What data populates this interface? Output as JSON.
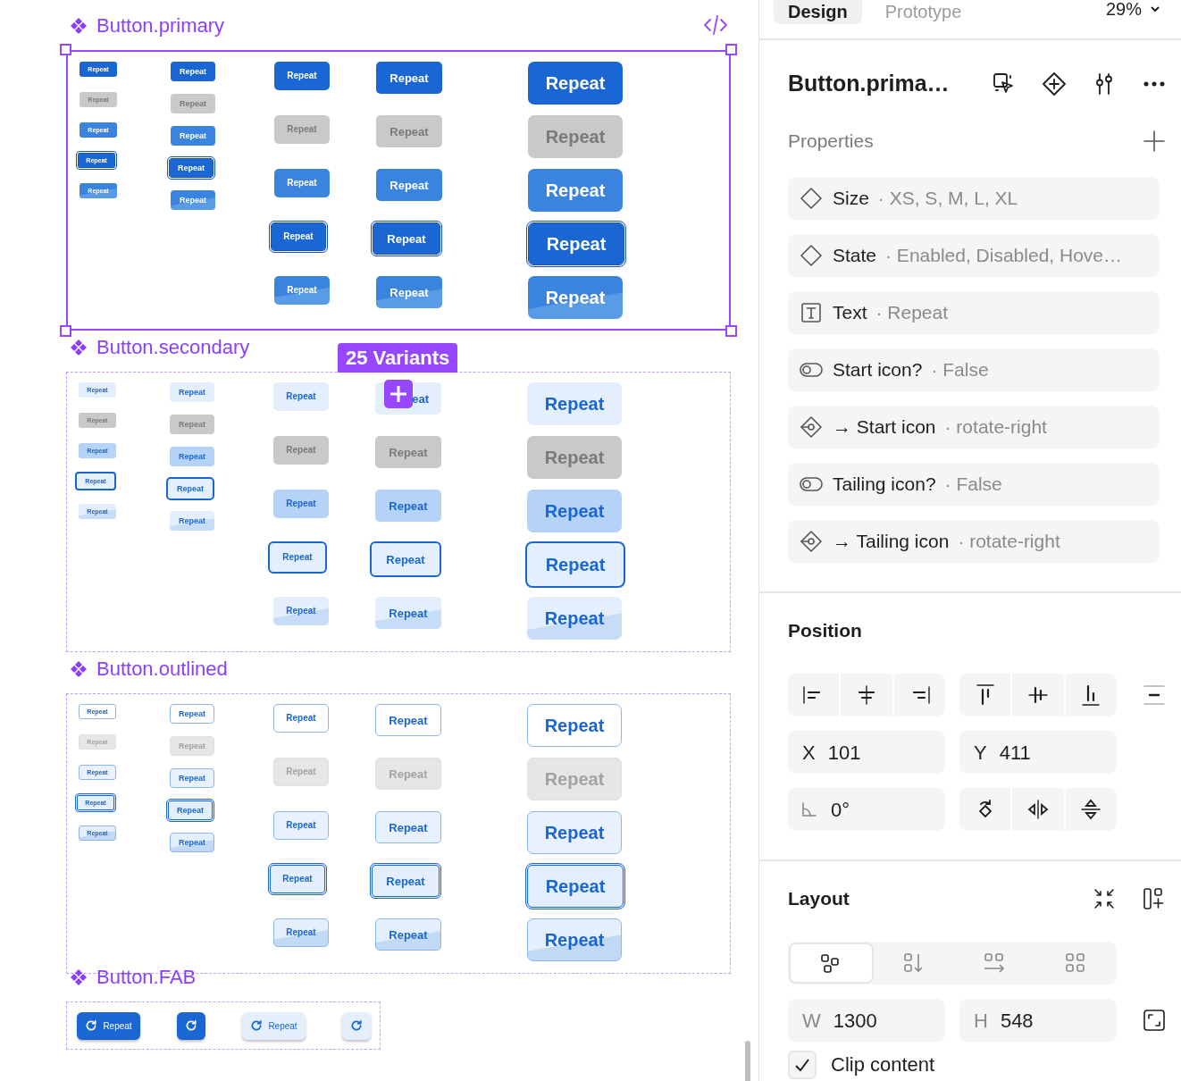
{
  "canvas": {
    "badge": "25 Variants",
    "sections": [
      {
        "title": "Button.primary",
        "kind": "primary",
        "selected": true,
        "columns": [
          {
            "kind": "XS",
            "buttons": [
              {
                "kind": "enabled",
                "label": "Repeat"
              },
              {
                "kind": "disabled",
                "label": "Repeat"
              },
              {
                "kind": "hovered",
                "label": "Repeat"
              },
              {
                "kind": "focused",
                "label": "Repeat"
              },
              {
                "kind": "pressed",
                "label": "Repeat"
              }
            ]
          },
          {
            "kind": "S",
            "buttons": [
              {
                "kind": "enabled",
                "label": "Repeat"
              },
              {
                "kind": "disabled",
                "label": "Repeat"
              },
              {
                "kind": "hovered",
                "label": "Repeat"
              },
              {
                "kind": "focused",
                "label": "Repeat"
              },
              {
                "kind": "pressed",
                "label": "Repeat"
              }
            ]
          },
          {
            "kind": "M",
            "buttons": [
              {
                "kind": "enabled",
                "label": "Repeat"
              },
              {
                "kind": "disabled",
                "label": "Repeat"
              },
              {
                "kind": "hovered",
                "label": "Repeat"
              },
              {
                "kind": "focused",
                "label": "Repeat"
              },
              {
                "kind": "pressed",
                "label": "Repeat"
              }
            ]
          },
          {
            "kind": "L",
            "buttons": [
              {
                "kind": "enabled",
                "label": "Repeat"
              },
              {
                "kind": "disabled",
                "label": "Repeat"
              },
              {
                "kind": "hovered",
                "label": "Repeat"
              },
              {
                "kind": "focused",
                "label": "Repeat"
              },
              {
                "kind": "pressed",
                "label": "Repeat"
              }
            ]
          },
          {
            "kind": "XL",
            "buttons": [
              {
                "kind": "enabled",
                "label": "Repeat"
              },
              {
                "kind": "disabled",
                "label": "Repeat"
              },
              {
                "kind": "hovered",
                "label": "Repeat"
              },
              {
                "kind": "focused",
                "label": "Repeat"
              },
              {
                "kind": "pressed",
                "label": "Repeat"
              }
            ]
          }
        ]
      },
      {
        "title": "Button.secondary",
        "kind": "secondary",
        "selected": false,
        "columns": [
          {
            "kind": "XS",
            "buttons": [
              {
                "kind": "enabled",
                "label": "Repeat"
              },
              {
                "kind": "disabled",
                "label": "Repeat"
              },
              {
                "kind": "hovered",
                "label": "Repeat"
              },
              {
                "kind": "focused",
                "label": "Repeat"
              },
              {
                "kind": "pressed",
                "label": "Repeat"
              }
            ]
          },
          {
            "kind": "S",
            "buttons": [
              {
                "kind": "enabled",
                "label": "Repeat"
              },
              {
                "kind": "disabled",
                "label": "Repeat"
              },
              {
                "kind": "hovered",
                "label": "Repeat"
              },
              {
                "kind": "focused",
                "label": "Repeat"
              },
              {
                "kind": "pressed",
                "label": "Repeat"
              }
            ]
          },
          {
            "kind": "M",
            "buttons": [
              {
                "kind": "enabled",
                "label": "Repeat"
              },
              {
                "kind": "disabled",
                "label": "Repeat"
              },
              {
                "kind": "hovered",
                "label": "Repeat"
              },
              {
                "kind": "focused",
                "label": "Repeat"
              },
              {
                "kind": "pressed",
                "label": "Repeat"
              }
            ]
          },
          {
            "kind": "L",
            "buttons": [
              {
                "kind": "enabled",
                "label": "eat",
                "covered": true
              },
              {
                "kind": "disabled",
                "label": "Repeat"
              },
              {
                "kind": "hovered",
                "label": "Repeat"
              },
              {
                "kind": "focused",
                "label": "Repeat"
              },
              {
                "kind": "pressed",
                "label": "Repeat"
              }
            ]
          },
          {
            "kind": "XL",
            "buttons": [
              {
                "kind": "enabled",
                "label": "Repeat"
              },
              {
                "kind": "disabled",
                "label": "Repeat"
              },
              {
                "kind": "hovered",
                "label": "Repeat"
              },
              {
                "kind": "focused",
                "label": "Repeat"
              },
              {
                "kind": "pressed",
                "label": "Repeat"
              }
            ]
          }
        ]
      },
      {
        "title": "Button.outlined",
        "kind": "outlined",
        "selected": false,
        "columns": [
          {
            "kind": "XS",
            "buttons": [
              {
                "kind": "enabled",
                "label": "Repeat"
              },
              {
                "kind": "disabled",
                "label": "Repeat"
              },
              {
                "kind": "hovered",
                "label": "Repeat"
              },
              {
                "kind": "focused",
                "label": "Repeat"
              },
              {
                "kind": "pressed",
                "label": "Repeat"
              }
            ]
          },
          {
            "kind": "S",
            "buttons": [
              {
                "kind": "enabled",
                "label": "Repeat"
              },
              {
                "kind": "disabled",
                "label": "Repeat"
              },
              {
                "kind": "hovered",
                "label": "Repeat"
              },
              {
                "kind": "focused",
                "label": "Repeat"
              },
              {
                "kind": "pressed",
                "label": "Repeat"
              }
            ]
          },
          {
            "kind": "M",
            "buttons": [
              {
                "kind": "enabled",
                "label": "Repeat"
              },
              {
                "kind": "disabled",
                "label": "Repeat"
              },
              {
                "kind": "hovered",
                "label": "Repeat"
              },
              {
                "kind": "focused",
                "label": "Repeat"
              },
              {
                "kind": "pressed",
                "label": "Repeat"
              }
            ]
          },
          {
            "kind": "L",
            "buttons": [
              {
                "kind": "enabled",
                "label": "Repeat"
              },
              {
                "kind": "disabled",
                "label": "Repeat"
              },
              {
                "kind": "hovered",
                "label": "Repeat"
              },
              {
                "kind": "focused",
                "label": "Repeat"
              },
              {
                "kind": "pressed",
                "label": "Repeat"
              }
            ]
          },
          {
            "kind": "XL",
            "buttons": [
              {
                "kind": "enabled",
                "label": "Repeat"
              },
              {
                "kind": "disabled",
                "label": "Repeat"
              },
              {
                "kind": "hovered",
                "label": "Repeat"
              },
              {
                "kind": "focused",
                "label": "Repeat"
              },
              {
                "kind": "pressed",
                "label": "Repeat"
              }
            ]
          }
        ]
      }
    ],
    "fab": {
      "title": "Button.FAB",
      "selected": false,
      "buttons": [
        {
          "kind": "primary",
          "label": "Repeat"
        },
        {
          "kind": "primary"
        },
        {
          "kind": "secondary",
          "label": "Repeat"
        },
        {
          "kind": "secondary"
        }
      ]
    }
  },
  "panel": {
    "tabs": [
      {
        "label": "Design",
        "selected": true
      },
      {
        "label": "Prototype",
        "selected": false
      }
    ],
    "zoom": "29%",
    "title": "Button.prima…",
    "properties": {
      "heading": "Properties",
      "items": [
        {
          "kind": "variant",
          "name": "Size",
          "value": "· XS, S, M, L, XL"
        },
        {
          "kind": "variant",
          "name": "State",
          "value": "· Enabled, Disabled, Hove…"
        },
        {
          "kind": "text",
          "name": "Text",
          "value": "· Repeat"
        },
        {
          "kind": "boolean",
          "name": "Start icon?",
          "value": "· False"
        },
        {
          "kind": "instance",
          "name": "→ Start icon",
          "value": "· rotate-right"
        },
        {
          "kind": "boolean",
          "name": "Tailing icon?",
          "value": "· False"
        },
        {
          "kind": "instance",
          "name": "→ Tailing icon",
          "value": "· rotate-right"
        }
      ]
    },
    "position": {
      "heading": "Position",
      "fields": [
        {
          "label": "X",
          "value": "101"
        },
        {
          "label": "Y",
          "value": "411"
        }
      ],
      "rotation": "0°"
    },
    "layout": {
      "heading": "Layout",
      "modes": [
        {
          "selected": true
        },
        {
          "selected": false
        },
        {
          "selected": false
        },
        {
          "selected": false
        }
      ],
      "fields": [
        {
          "label": "W",
          "value": "1300"
        },
        {
          "label": "H",
          "value": "548"
        }
      ],
      "clip": {
        "label": "Clip content",
        "checked": true
      }
    }
  }
}
